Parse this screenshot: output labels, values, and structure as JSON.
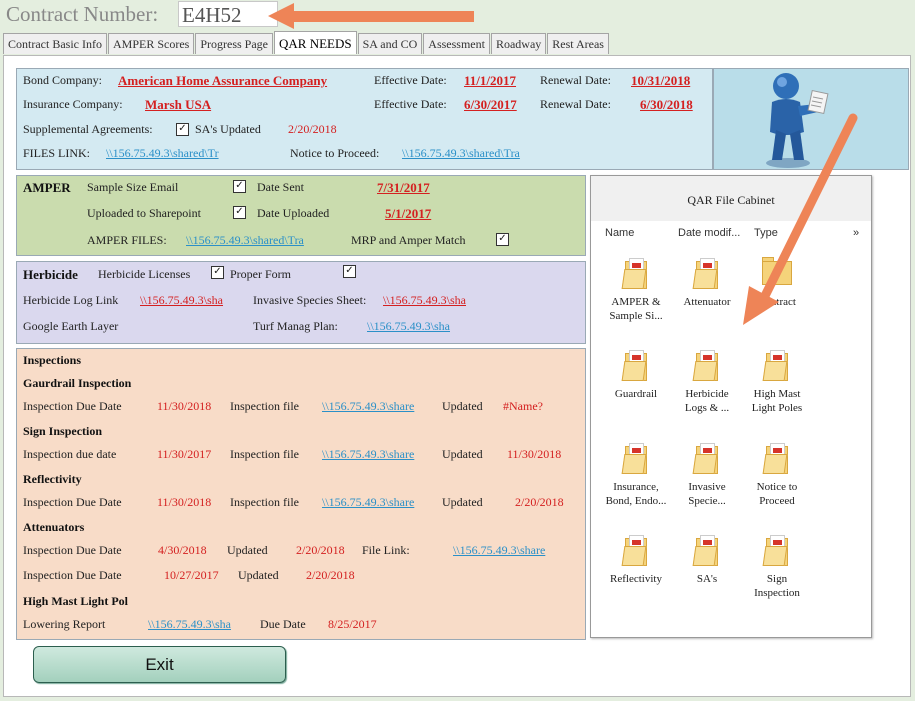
{
  "header": {
    "contract_label": "Contract Number:",
    "contract_value": "E4H52"
  },
  "tabs": [
    {
      "label": "Contract Basic Info"
    },
    {
      "label": "AMPER Scores"
    },
    {
      "label": "Progress Page"
    },
    {
      "label": "QAR NEEDS",
      "active": true
    },
    {
      "label": "SA and CO"
    },
    {
      "label": "Assessment"
    },
    {
      "label": "Roadway"
    },
    {
      "label": "Rest Areas"
    }
  ],
  "bond": {
    "bond_company_label": "Bond Company:",
    "bond_company": "American Home Assurance Company",
    "effective_date_label_1": "Effective Date:",
    "effective_date_1": "11/1/2017",
    "renewal_date_label_1": "Renewal Date:",
    "renewal_date_1": "10/31/2018",
    "insurance_company_label": "Insurance Company:",
    "insurance_company": "Marsh USA",
    "effective_date_label_2": "Effective Date:",
    "effective_date_2": "6/30/2017",
    "renewal_date_label_2": "Renewal Date:",
    "renewal_date_2": "6/30/2018",
    "supplemental_label": "Supplemental Agreements:",
    "sa_updated_label": "SA's Updated",
    "sa_updated_date": "2/20/2018",
    "files_link_label": "FILES LINK:",
    "files_link": "\\\\156.75.49.3\\shared\\Tr",
    "ntp_label": "Notice to Proceed:",
    "ntp_link": "\\\\156.75.49.3\\shared\\Tra"
  },
  "amper": {
    "title": "AMPER",
    "sample_size_label": "Sample Size Email",
    "date_sent_label": "Date Sent",
    "date_sent": "7/31/2017",
    "uploaded_label": "Uploaded to Sharepoint",
    "date_uploaded_label": "Date Uploaded",
    "date_uploaded": "5/1/2017",
    "files_label": "AMPER FILES:",
    "files_link": "\\\\156.75.49.3\\shared\\Tra",
    "mrp_label": "MRP and Amper Match"
  },
  "herbicide": {
    "title": "Herbicide",
    "licenses_label": "Herbicide Licenses",
    "proper_form_label": "Proper Form",
    "log_link_label": "Herbicide Log Link",
    "log_link": "\\\\156.75.49.3\\sha",
    "invasive_label": "Invasive Species Sheet:",
    "invasive_link": "\\\\156.75.49.3\\sha",
    "google_label": "Google Earth Layer",
    "turf_label": "Turf Manag Plan:",
    "turf_link": "\\\\156.75.49.3\\sha"
  },
  "inspections": {
    "title": "Inspections",
    "guardrail_title": "Gaurdrail Inspection",
    "guardrail_due_label": "Inspection Due Date",
    "guardrail_due": "11/30/2018",
    "guardrail_file_label": "Inspection file",
    "guardrail_file": "\\\\156.75.49.3\\share",
    "guardrail_updated_label": "Updated",
    "guardrail_updated": "#Name?",
    "sign_title": "Sign Inspection",
    "sign_due_label": "Inspection due date",
    "sign_due": "11/30/2017",
    "sign_file_label": "Inspection file",
    "sign_file": "\\\\156.75.49.3\\share",
    "sign_updated_label": "Updated",
    "sign_updated": "11/30/2018",
    "refl_title": "Reflectivity",
    "refl_due_label": "Inspection Due Date",
    "refl_due": "11/30/2018",
    "refl_file_label": "Inspection file",
    "refl_file": "\\\\156.75.49.3\\share",
    "refl_updated_label": "Updated",
    "refl_updated": "2/20/2018",
    "att_title": "Attenuators",
    "att_due_label_1": "Inspection Due Date",
    "att_due_1": "4/30/2018",
    "att_updated_label_1": "Updated",
    "att_updated_1": "2/20/2018",
    "att_file_label": "File Link:",
    "att_file": "\\\\156.75.49.3\\share",
    "att_due_label_2": "Inspection Due Date",
    "att_due_2": "10/27/2017",
    "att_updated_label_2": "Updated",
    "att_updated_2": "2/20/2018",
    "hm_title": "High Mast Light Pol",
    "lowering_label": "Lowering Report",
    "lowering_link": "\\\\156.75.49.3\\sha",
    "hm_due_label": "Due Date",
    "hm_due": "8/25/2017"
  },
  "cabinet": {
    "title": "QAR File Cabinet",
    "col_name": "Name",
    "col_date": "Date modif...",
    "col_type": "Type",
    "more": "»",
    "items": [
      {
        "l1": "AMPER &",
        "l2": "Sample Si...",
        "kind": "pdf-folder"
      },
      {
        "l1": "Attenuator",
        "l2": "",
        "kind": "pdf-folder"
      },
      {
        "l1": "Contract",
        "l2": "",
        "kind": "folder"
      },
      {
        "l1": "Guardrail",
        "l2": "",
        "kind": "pdf-folder"
      },
      {
        "l1": "Herbicide",
        "l2": "Logs & ...",
        "kind": "pdf-folder"
      },
      {
        "l1": "High Mast",
        "l2": "Light Poles",
        "kind": "pdf-folder"
      },
      {
        "l1": "Insurance,",
        "l2": "Bond, Endo...",
        "kind": "pdf-folder"
      },
      {
        "l1": "Invasive",
        "l2": "Specie...",
        "kind": "pdf-folder"
      },
      {
        "l1": "Notice to",
        "l2": "Proceed",
        "kind": "pdf-folder"
      },
      {
        "l1": "Reflectivity",
        "l2": "",
        "kind": "pdf-folder"
      },
      {
        "l1": "SA's",
        "l2": "",
        "kind": "pdf-folder"
      },
      {
        "l1": "Sign",
        "l2": "Inspection",
        "kind": "pdf-folder"
      }
    ]
  },
  "exit_label": "Exit",
  "check_glyph": "✓",
  "icons": {
    "mascot": "blue-figure-reading-icon",
    "arrow": "orange-arrow-icon"
  },
  "colors": {
    "accent_red": "#d42020",
    "link_blue": "#2b90c8",
    "arrow_orange": "#ee8457"
  }
}
